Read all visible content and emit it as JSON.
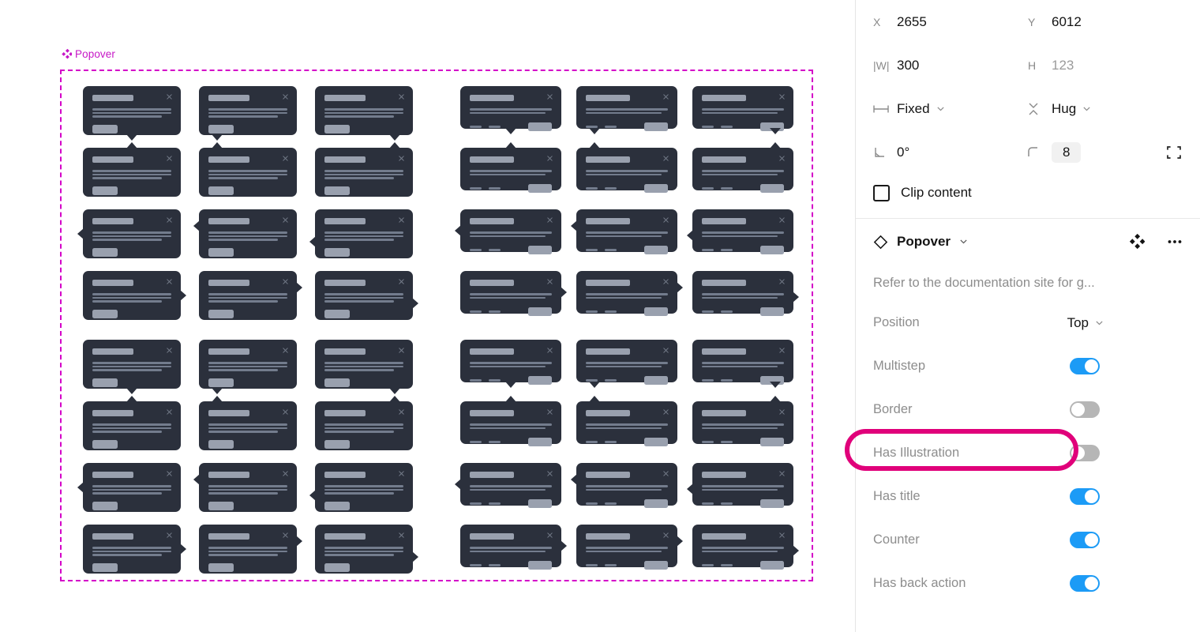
{
  "canvas": {
    "frame_label": "Popover",
    "frame_label_icon": "component-diamonds-icon"
  },
  "panel": {
    "geometry": {
      "x_label": "X",
      "x_value": "2655",
      "y_label": "Y",
      "y_value": "6012",
      "w_label": "|W|",
      "w_value": "300",
      "h_label": "H",
      "h_value": "123",
      "horizontal_resize": "Fixed",
      "vertical_resize": "Hug",
      "rotation": "0°",
      "corner_radius": "8",
      "clip_content_label": "Clip content",
      "clip_content_checked": false
    },
    "component": {
      "name": "Popover",
      "description": "Refer to the documentation site for g...",
      "properties": [
        {
          "label": "Position",
          "type": "select",
          "value": "Top"
        },
        {
          "label": "Multistep",
          "type": "toggle",
          "value": true
        },
        {
          "label": "Border",
          "type": "toggle",
          "value": false,
          "highlighted": true
        },
        {
          "label": "Has Illustration",
          "type": "toggle",
          "value": false
        },
        {
          "label": "Has title",
          "type": "toggle",
          "value": true
        },
        {
          "label": "Counter",
          "type": "toggle",
          "value": true
        },
        {
          "label": "Has back action",
          "type": "toggle",
          "value": true
        }
      ]
    }
  },
  "colors": {
    "frame_outline": "#D400C8",
    "frame_label": "#C617C6",
    "highlight_ring": "#E0007A",
    "toggle_on": "#1C9BF6",
    "toggle_off": "#B6B6B6",
    "popover_bg": "#2B303C",
    "placeholder_light": "#99A0AE",
    "placeholder_dark": "#737C8D"
  },
  "popover_grid": {
    "rows": 8,
    "columns": 6,
    "left_group_columns": 3,
    "right_group_columns": 3,
    "arrow_positions_by_row": [
      "bottom-center",
      "top-center",
      "left-middle",
      "right-middle",
      "bottom-center",
      "top-center",
      "left-middle",
      "right-middle"
    ]
  }
}
